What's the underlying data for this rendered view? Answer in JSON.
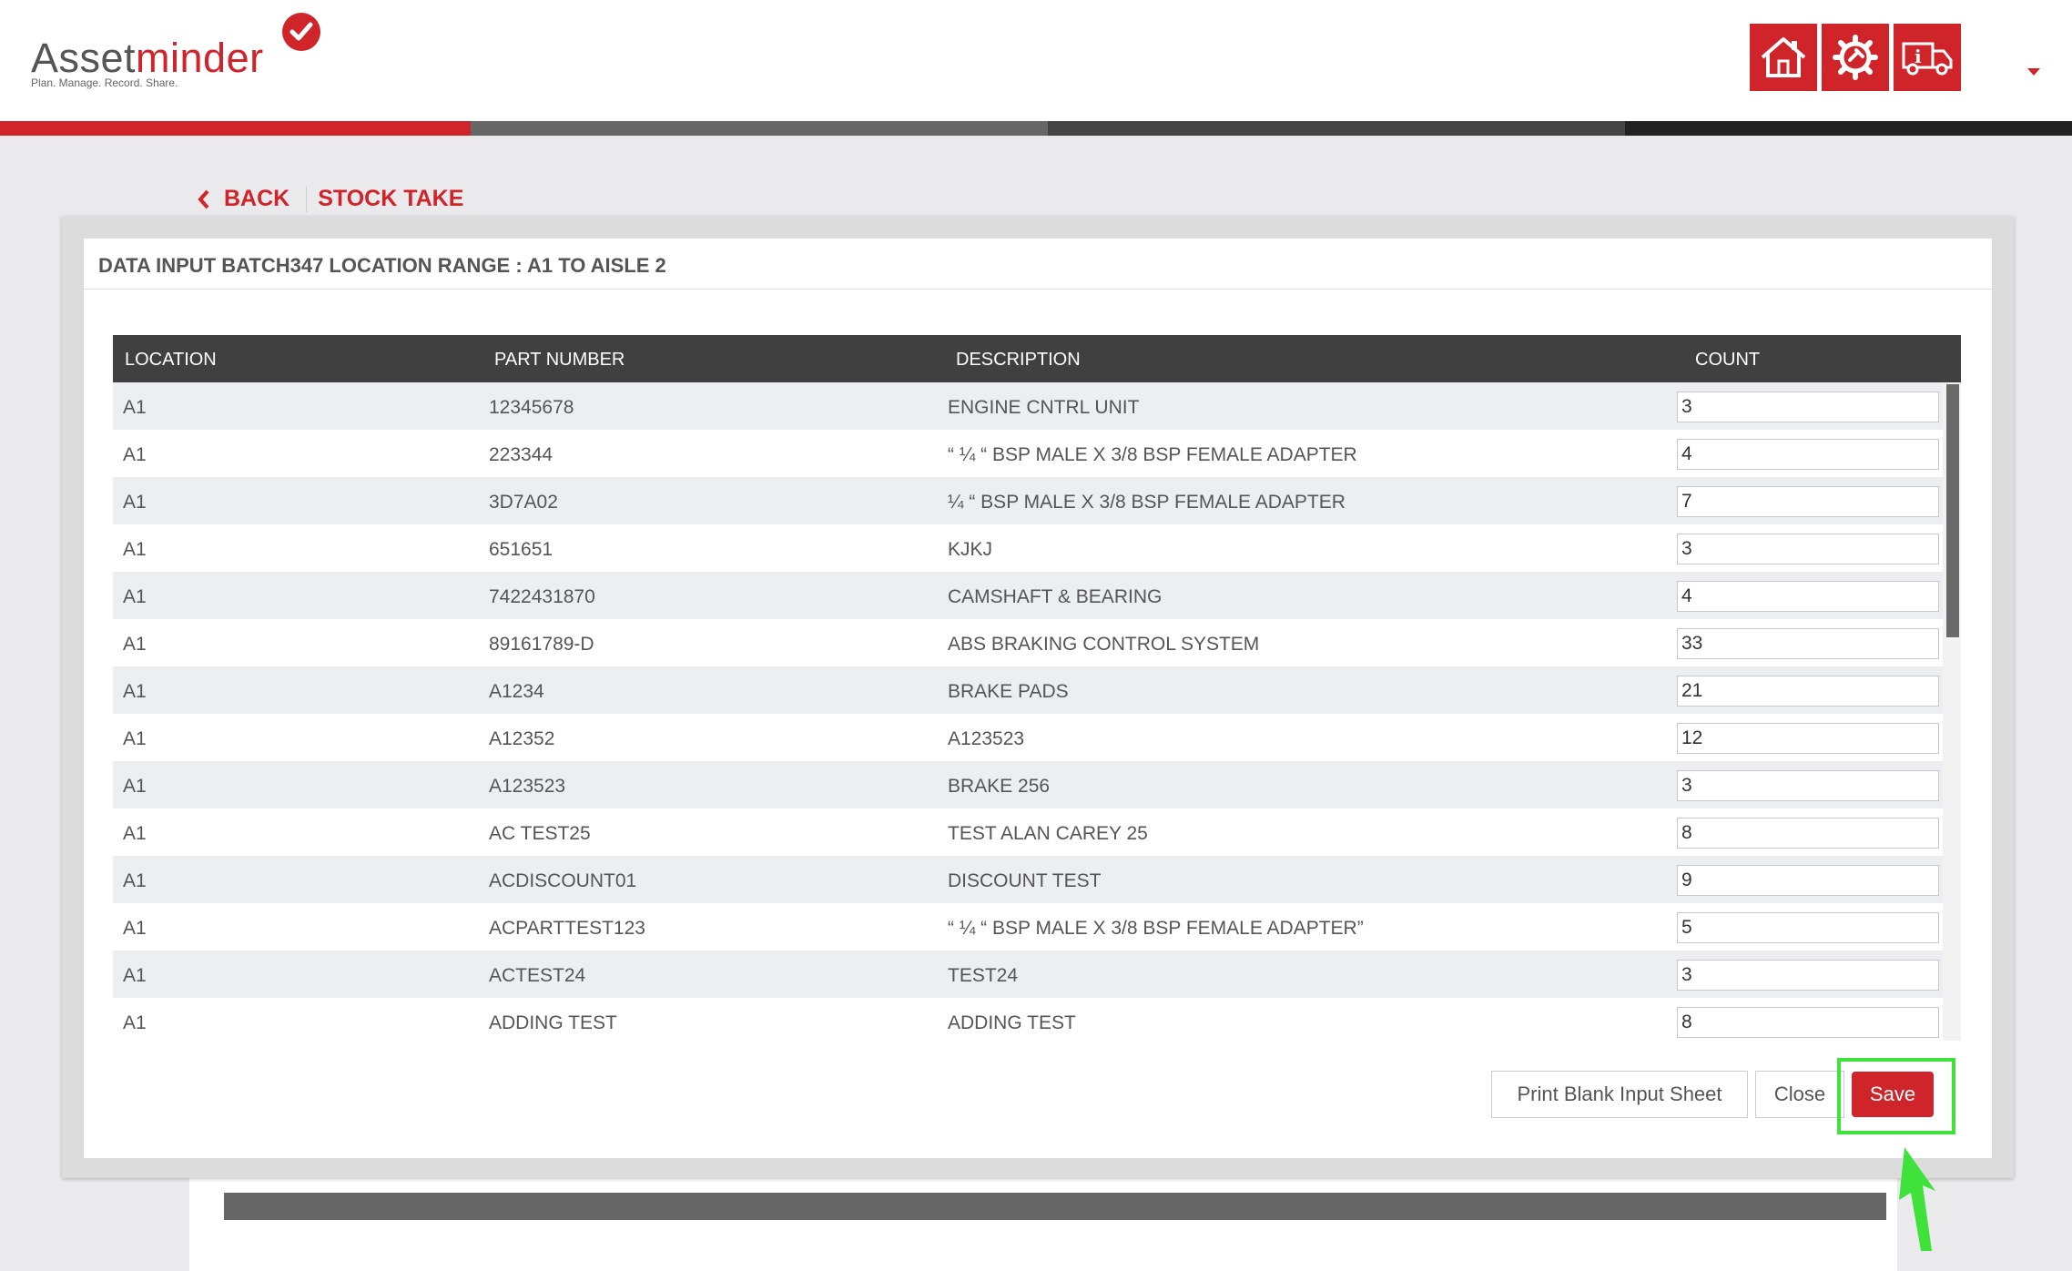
{
  "logo": {
    "brand_part1": "Asset",
    "brand_part2": "minder",
    "tagline": "Plan. Manage. Record. Share."
  },
  "header": {
    "icons": [
      "home-icon",
      "settings-gear-icon",
      "delivery-truck-icon"
    ],
    "colors": {
      "accent": "#d0242b"
    }
  },
  "stripe_colors": [
    "#d0242b",
    "#666666",
    "#444444",
    "#222222"
  ],
  "breadcrumb": {
    "back_label": "BACK",
    "page_label": "STOCK TAKE"
  },
  "modal": {
    "title": "DATA INPUT BATCH347 LOCATION RANGE : A1 TO AISLE 2",
    "columns": {
      "location": "LOCATION",
      "part_number": "PART NUMBER",
      "description": "DESCRIPTION",
      "count": "COUNT"
    },
    "rows": [
      {
        "location": "A1",
        "part_number": "12345678",
        "description": "ENGINE CNTRL UNIT",
        "count": "3"
      },
      {
        "location": "A1",
        "part_number": "223344",
        "description": "“ ¼ “ BSP MALE X 3/8 BSP FEMALE ADAPTER",
        "count": "4"
      },
      {
        "location": "A1",
        "part_number": "3D7A02",
        "description": "¼ “ BSP MALE X 3/8 BSP FEMALE ADAPTER",
        "count": "7"
      },
      {
        "location": "A1",
        "part_number": "651651",
        "description": "KJKJ",
        "count": "3"
      },
      {
        "location": "A1",
        "part_number": "7422431870",
        "description": "CAMSHAFT & BEARING",
        "count": "4"
      },
      {
        "location": "A1",
        "part_number": "89161789-D",
        "description": "ABS BRAKING CONTROL SYSTEM",
        "count": "33"
      },
      {
        "location": "A1",
        "part_number": "A1234",
        "description": "BRAKE PADS",
        "count": "21"
      },
      {
        "location": "A1",
        "part_number": "A12352",
        "description": "A123523",
        "count": "12"
      },
      {
        "location": "A1",
        "part_number": "A123523",
        "description": "BRAKE 256",
        "count": "3"
      },
      {
        "location": "A1",
        "part_number": "AC TEST25",
        "description": "TEST ALAN CAREY 25",
        "count": "8"
      },
      {
        "location": "A1",
        "part_number": "ACDISCOUNT01",
        "description": "DISCOUNT TEST",
        "count": "9"
      },
      {
        "location": "A1",
        "part_number": "ACPARTTEST123",
        "description": "“ ¼ “ BSP MALE X 3/8 BSP FEMALE ADAPTER”",
        "count": "5"
      },
      {
        "location": "A1",
        "part_number": "ACTEST24",
        "description": "TEST24",
        "count": "3"
      },
      {
        "location": "A1",
        "part_number": "ADDING TEST",
        "description": "ADDING TEST",
        "count": "8"
      }
    ],
    "buttons": {
      "print": "Print Blank Input Sheet",
      "close": "Close",
      "save": "Save"
    }
  }
}
